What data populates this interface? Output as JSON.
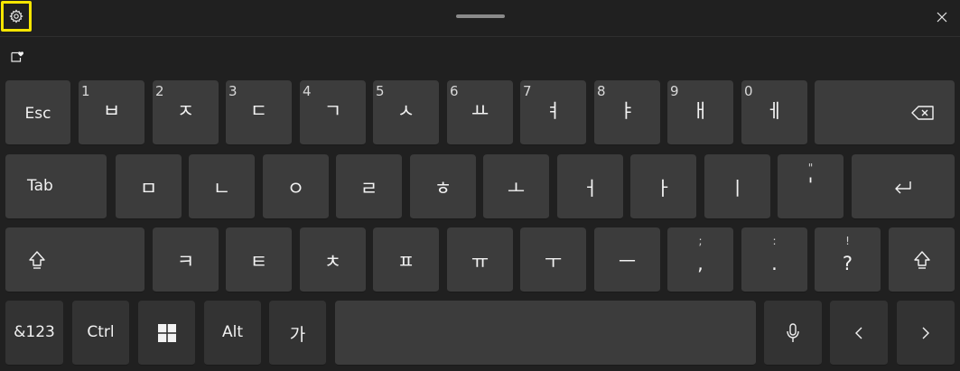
{
  "row1": [
    {
      "id": "esc",
      "label": "Esc"
    },
    {
      "id": "b",
      "num": "1",
      "label": "ㅂ"
    },
    {
      "id": "j",
      "num": "2",
      "label": "ㅈ"
    },
    {
      "id": "d",
      "num": "3",
      "label": "ㄷ"
    },
    {
      "id": "g",
      "num": "4",
      "label": "ㄱ"
    },
    {
      "id": "s",
      "num": "5",
      "label": "ㅅ"
    },
    {
      "id": "yo",
      "num": "6",
      "label": "ㅛ"
    },
    {
      "id": "yeo",
      "num": "7",
      "label": "ㅕ"
    },
    {
      "id": "ya",
      "num": "8",
      "label": "ㅑ"
    },
    {
      "id": "ae",
      "num": "9",
      "label": "ㅐ"
    },
    {
      "id": "e",
      "num": "0",
      "label": "ㅔ"
    }
  ],
  "row2": [
    {
      "id": "tab",
      "label": "Tab"
    },
    {
      "id": "m",
      "label": "ㅁ"
    },
    {
      "id": "n",
      "label": "ㄴ"
    },
    {
      "id": "ng",
      "label": "ㅇ"
    },
    {
      "id": "r",
      "label": "ㄹ"
    },
    {
      "id": "h",
      "label": "ㅎ"
    },
    {
      "id": "o",
      "label": "ㅗ"
    },
    {
      "id": "eo",
      "label": "ㅓ"
    },
    {
      "id": "a",
      "label": "ㅏ"
    },
    {
      "id": "i",
      "label": "ㅣ"
    },
    {
      "id": "quote",
      "small": "\"",
      "label": "'"
    }
  ],
  "row3": [
    {
      "id": "k",
      "label": "ㅋ"
    },
    {
      "id": "t",
      "label": "ㅌ"
    },
    {
      "id": "ch",
      "label": "ㅊ"
    },
    {
      "id": "p",
      "label": "ㅍ"
    },
    {
      "id": "yu",
      "label": "ㅠ"
    },
    {
      "id": "u",
      "label": "ㅜ"
    },
    {
      "id": "eu",
      "label": "ㅡ"
    },
    {
      "id": "comma",
      "small": ";",
      "label": ","
    },
    {
      "id": "period",
      "small": ":",
      "label": "."
    },
    {
      "id": "question",
      "small": "!",
      "label": "?"
    }
  ],
  "row4": {
    "symbols": "&123",
    "ctrl": "Ctrl",
    "alt": "Alt",
    "lang": "가"
  },
  "icons": {
    "settings": "gear-icon",
    "close": "close-icon",
    "sticker": "sticker-heart-icon",
    "backspace": "backspace-icon",
    "enter": "enter-icon",
    "shift": "shift-icon",
    "windows": "windows-logo-icon",
    "mic": "microphone-icon",
    "left": "chevron-left-icon",
    "right": "chevron-right-icon"
  },
  "colors": {
    "background": "#202020",
    "key": "#3c3c3c",
    "key_dark": "#333333",
    "focus_outline": "#f5e500"
  }
}
